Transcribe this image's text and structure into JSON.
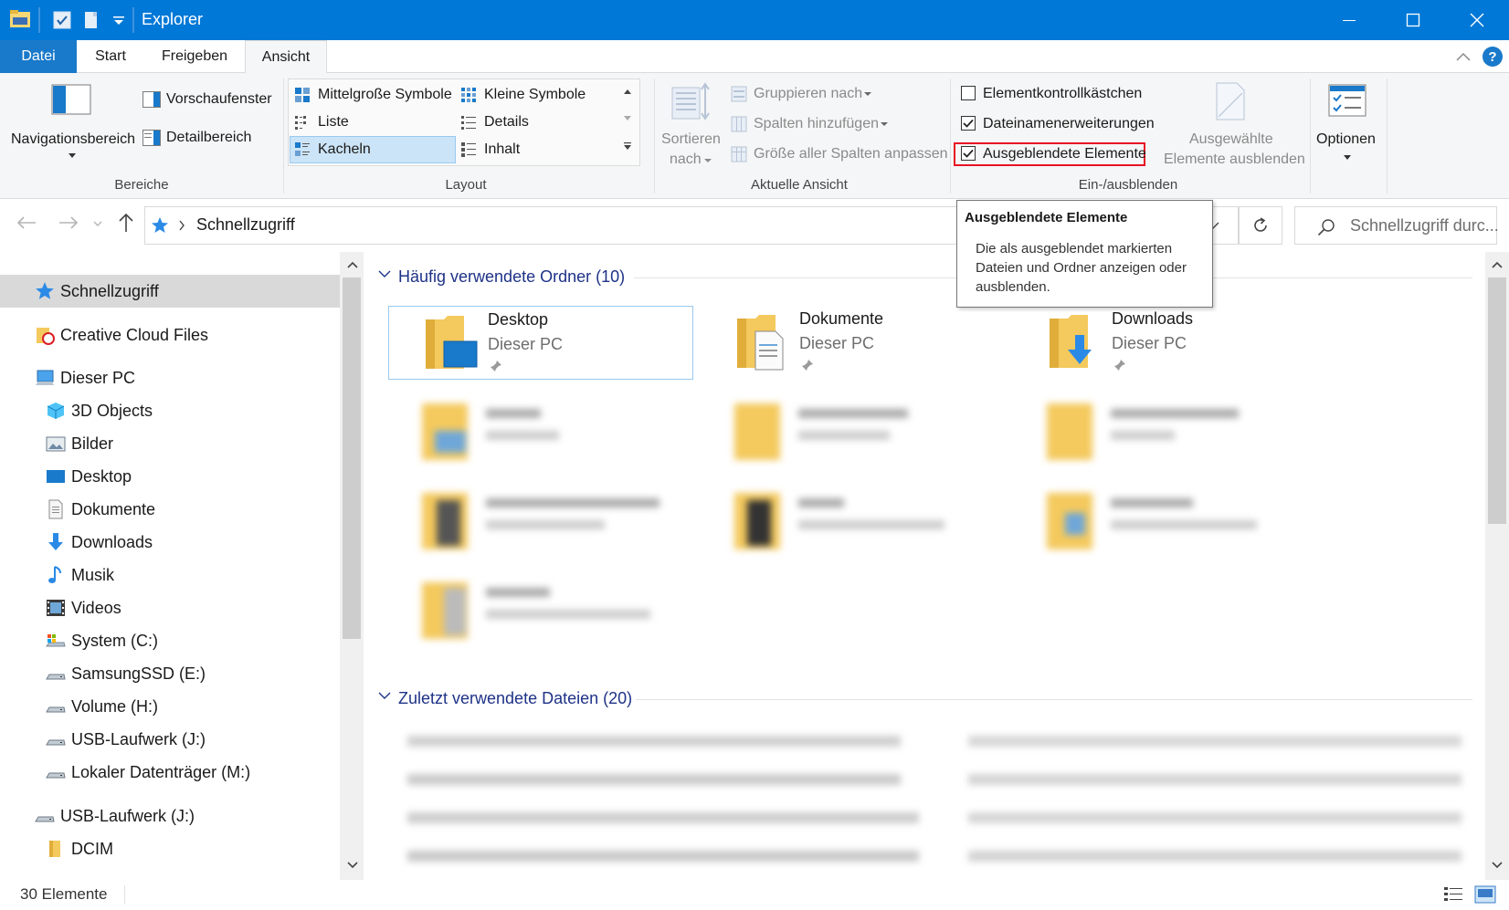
{
  "window": {
    "title": "Explorer",
    "colors": {
      "titlebar": "#0078d7",
      "file_tab": "#1979ca",
      "accent_blue": "#0078d7",
      "highlight_box": "#e81123"
    }
  },
  "tabs": [
    {
      "label": "Datei"
    },
    {
      "label": "Start"
    },
    {
      "label": "Freigeben"
    },
    {
      "label": "Ansicht"
    }
  ],
  "ribbon": {
    "bereiche": {
      "label": "Bereiche",
      "navigationsbereich": "Navigationsbereich",
      "vorschaufenster": "Vorschaufenster",
      "detailbereich": "Detailbereich"
    },
    "layout": {
      "label": "Layout",
      "options": [
        {
          "label": "Mittelgroße Symbole"
        },
        {
          "label": "Kleine Symbole"
        },
        {
          "label": "Liste"
        },
        {
          "label": "Details"
        },
        {
          "label": "Kacheln"
        },
        {
          "label": "Inhalt"
        }
      ],
      "selected": "Kacheln"
    },
    "aktuelle_ansicht": {
      "label": "Aktuelle Ansicht",
      "sortieren": "Sortieren",
      "nach": "nach",
      "gruppieren": "Gruppieren nach",
      "spalten": "Spalten hinzufügen",
      "groesse": "Größe aller Spalten anpassen"
    },
    "einausblenden": {
      "label": "Ein-/ausblenden",
      "elementkontroll": {
        "label": "Elementkontrollkästchen",
        "checked": false
      },
      "dateinamen": {
        "label": "Dateinamenerweiterungen",
        "checked": true
      },
      "ausgeblendete": {
        "label": "Ausgeblendete Elemente",
        "checked": true
      },
      "ausgewaehlte_1": "Ausgewählte",
      "ausgewaehlte_2": "Elemente ausblenden"
    },
    "optionen": "Optionen"
  },
  "address": {
    "path": "Schnellzugriff",
    "search_placeholder": "Schnellzugriff durc..."
  },
  "tooltip": {
    "title": "Ausgeblendete Elemente",
    "line1": "Die als ausgeblendet markierten",
    "line2": "Dateien und Ordner anzeigen oder",
    "line3": "ausblenden."
  },
  "nav": {
    "items": [
      {
        "label": "Schnellzugriff",
        "icon": "star-icon"
      },
      {
        "label": "Creative Cloud Files",
        "icon": "creative-cloud-folder-icon"
      },
      {
        "label": "Dieser PC",
        "icon": "computer-icon"
      },
      {
        "label": "3D Objects",
        "icon": "cube-icon"
      },
      {
        "label": "Bilder",
        "icon": "pictures-icon"
      },
      {
        "label": "Desktop",
        "icon": "desktop-icon"
      },
      {
        "label": "Dokumente",
        "icon": "documents-icon"
      },
      {
        "label": "Downloads",
        "icon": "download-arrow-icon"
      },
      {
        "label": "Musik",
        "icon": "music-note-icon"
      },
      {
        "label": "Videos",
        "icon": "film-icon"
      },
      {
        "label": "System (C:)",
        "icon": "system-drive-icon"
      },
      {
        "label": "SamsungSSD (E:)",
        "icon": "drive-icon"
      },
      {
        "label": "Volume (H:)",
        "icon": "drive-icon"
      },
      {
        "label": "USB-Laufwerk (J:)",
        "icon": "drive-icon"
      },
      {
        "label": "Lokaler Datenträger (M:)",
        "icon": "drive-icon"
      },
      {
        "label": "USB-Laufwerk (J:)",
        "icon": "usb-drive-icon"
      },
      {
        "label": "DCIM",
        "icon": "folder-icon"
      }
    ]
  },
  "main": {
    "frequent": {
      "header": "Häufig verwendete Ordner (10)",
      "tiles": [
        {
          "name": "Desktop",
          "location": "Dieser PC"
        },
        {
          "name": "Dokumente",
          "location": "Dieser PC"
        },
        {
          "name": "Downloads",
          "location": "Dieser PC"
        }
      ]
    },
    "recent": {
      "header": "Zuletzt verwendete Dateien (20)"
    }
  },
  "status": {
    "count": "30 Elemente"
  }
}
